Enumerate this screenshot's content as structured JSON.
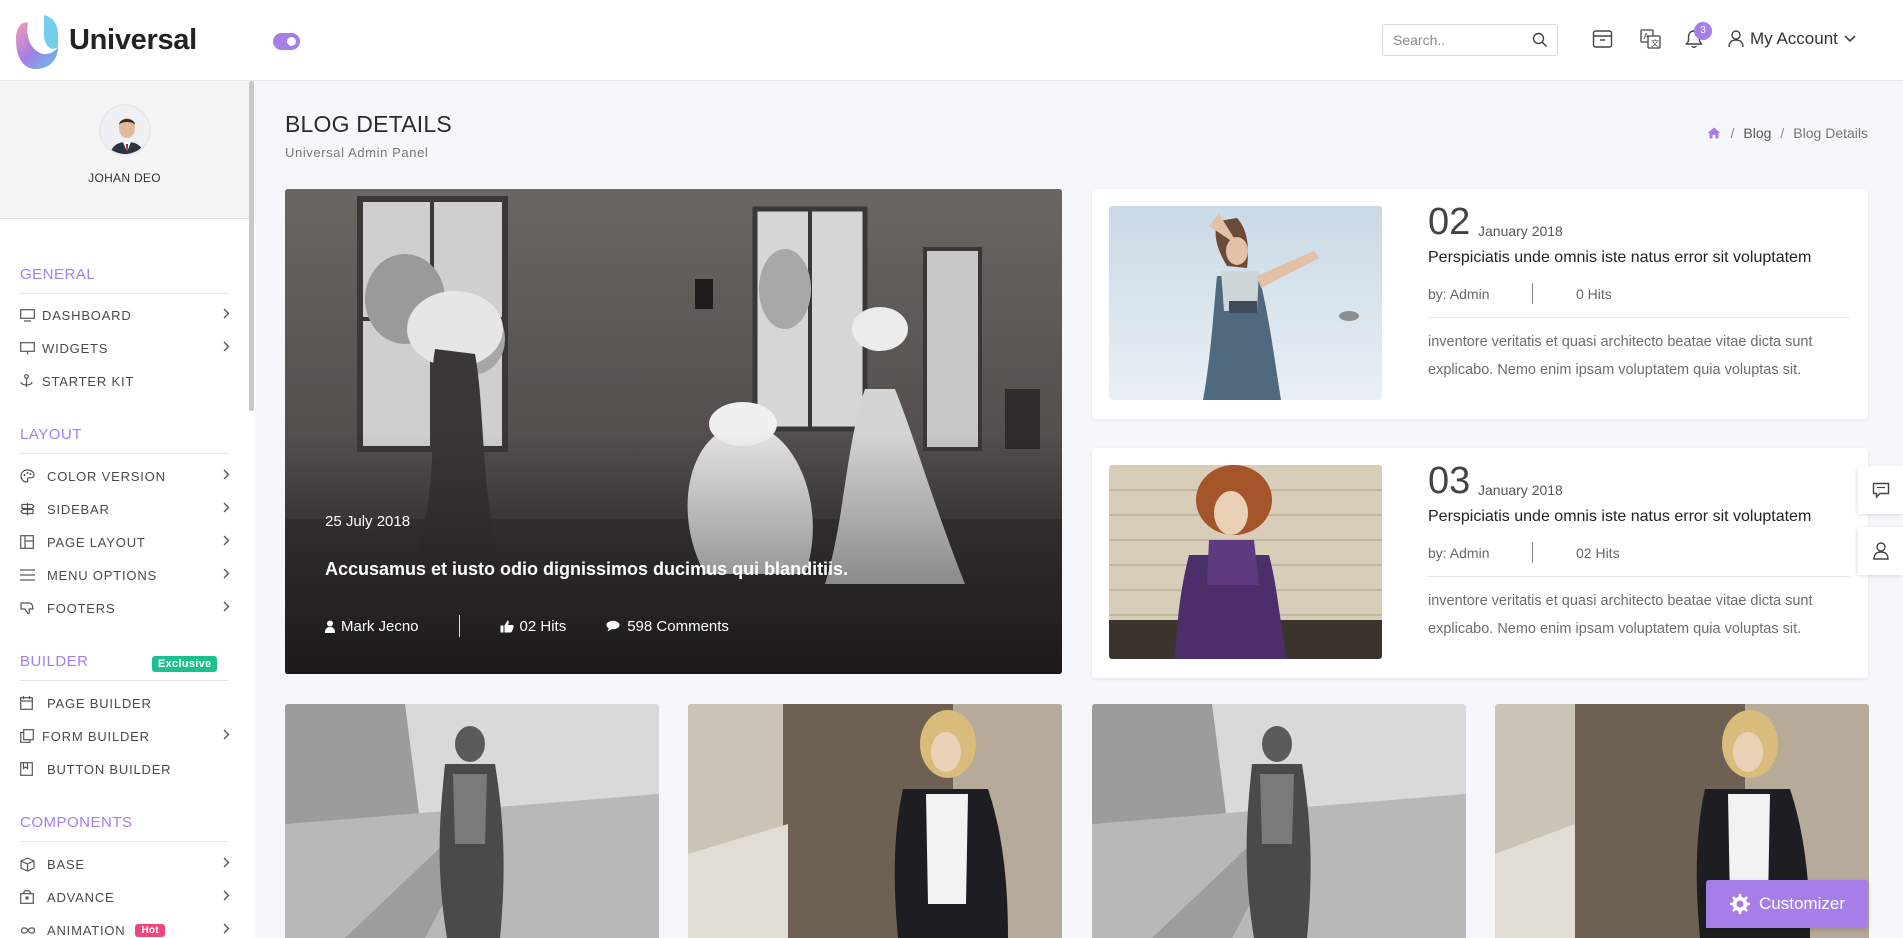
{
  "header": {
    "logo_text": "Universal",
    "search_placeholder": "Search..",
    "notification_count": "3",
    "account_label": "My Account"
  },
  "sidebar": {
    "profile_name": "JOHAN DEO",
    "sections": {
      "general": "GENERAL",
      "layout": "LAYOUT",
      "builder": "BUILDER",
      "builder_tag": "Exclusive",
      "components": "COMPONENTS"
    },
    "items": {
      "dashboard": "DASHBOARD",
      "widgets": "WIDGETS",
      "starter_kit": "STARTER KIT",
      "color_version": "COLOR VERSION",
      "sidebar": "SIDEBAR",
      "page_layout": "PAGE LAYOUT",
      "menu_options": "MENU OPTIONS",
      "footers": "FOOTERS",
      "page_builder": "PAGE BUILDER",
      "form_builder": "FORM BUILDER",
      "button_builder": "BUTTON BUILDER",
      "base": "BASE",
      "advance": "ADVANCE",
      "animation": "ANIMATION",
      "animation_tag": "Hot"
    }
  },
  "page": {
    "title": "BLOG DETAILS",
    "subtitle": "Universal Admin Panel",
    "breadcrumb": [
      "Blog",
      "Blog Details"
    ]
  },
  "hero": {
    "date": "25 July 2018",
    "title": "Accusamus et iusto odio dignissimos ducimus qui blanditiis.",
    "author": "Mark Jecno",
    "hits": "02 Hits",
    "comments": "598 Comments"
  },
  "posts": [
    {
      "day": "02",
      "month": "January 2018",
      "title": "Perspiciatis unde omnis iste natus error sit voluptatem",
      "by": "by: Admin",
      "hits": "0 Hits",
      "excerpt": "inventore veritatis et quasi architecto beatae vitae dicta sunt explicabo. Nemo enim ipsam voluptatem quia voluptas sit."
    },
    {
      "day": "03",
      "month": "January 2018",
      "title": "Perspiciatis unde omnis iste natus error sit voluptatem",
      "by": "by: Admin",
      "hits": "02 Hits",
      "excerpt": "inventore veritatis et quasi architecto beatae vitae dicta sunt explicabo. Nemo enim ipsam voluptatem quia voluptas sit."
    }
  ],
  "customizer_label": "Customizer",
  "colors": {
    "accent": "#a57ee8",
    "exclusive": "#1dbf8e",
    "hot": "#f0467b"
  }
}
